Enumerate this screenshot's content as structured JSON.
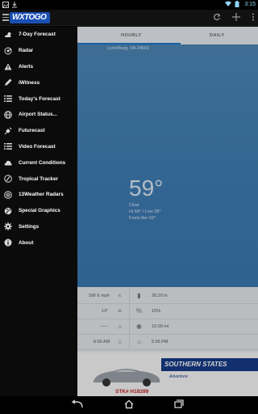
{
  "status_bar": {
    "time": "3:15"
  },
  "action_bar": {
    "logo_text": "WXTOGO",
    "icons": [
      "refresh-icon",
      "add-icon",
      "overflow-menu-icon"
    ]
  },
  "tabs": [
    {
      "label": "HOURLY"
    },
    {
      "label": "DAILY"
    }
  ],
  "location": "Lynchburg, VA 24501",
  "current": {
    "temperature": "59°",
    "condition": "Clear",
    "hi_lo": "Hi 68° / Low 38°",
    "feels_like": "Feels like 59°"
  },
  "details": {
    "wind": "SW 6 mph",
    "pressure": "30.20 in",
    "dewpoint": "13°",
    "humidity": "15%",
    "visibility_left": "-----",
    "visibility": "10.00 mi",
    "sunrise": "6:56 AM",
    "sunset": "5:55 PM"
  },
  "ad": {
    "banner": "SOUTHERN STATES",
    "subtitle": "Adventure",
    "price": "STK# H18399"
  },
  "drawer": {
    "items": [
      {
        "label": "7-Day Forecast",
        "icon": "cloud-sun-icon"
      },
      {
        "label": "Radar",
        "icon": "radar-icon"
      },
      {
        "label": "Alerts",
        "icon": "alert-triangle-icon"
      },
      {
        "label": "iWitness",
        "icon": "pencil-icon"
      },
      {
        "label": "Today's Forecast",
        "icon": "list-icon"
      },
      {
        "label": "Airport Status...",
        "icon": "globe-icon"
      },
      {
        "label": "Futurecast",
        "icon": "satellite-icon"
      },
      {
        "label": "Video Forecast",
        "icon": "video-list-icon"
      },
      {
        "label": "Current Conditions",
        "icon": "cloud-icon"
      },
      {
        "label": "Tropical Tracker",
        "icon": "hurricane-icon"
      },
      {
        "label": "13Weather Radars",
        "icon": "radar-icon"
      },
      {
        "label": "Special Graphics",
        "icon": "globe-icon"
      },
      {
        "label": "Settings",
        "icon": "gear-icon"
      },
      {
        "label": "About",
        "icon": "info-icon"
      }
    ]
  },
  "colors": {
    "drawer_bg": "#0b0b0b",
    "sky": "#3f7db3",
    "tab_accent": "#1f77c9",
    "logo_blue": "#1a4fb3",
    "logo_yellow": "#ffd21f"
  }
}
